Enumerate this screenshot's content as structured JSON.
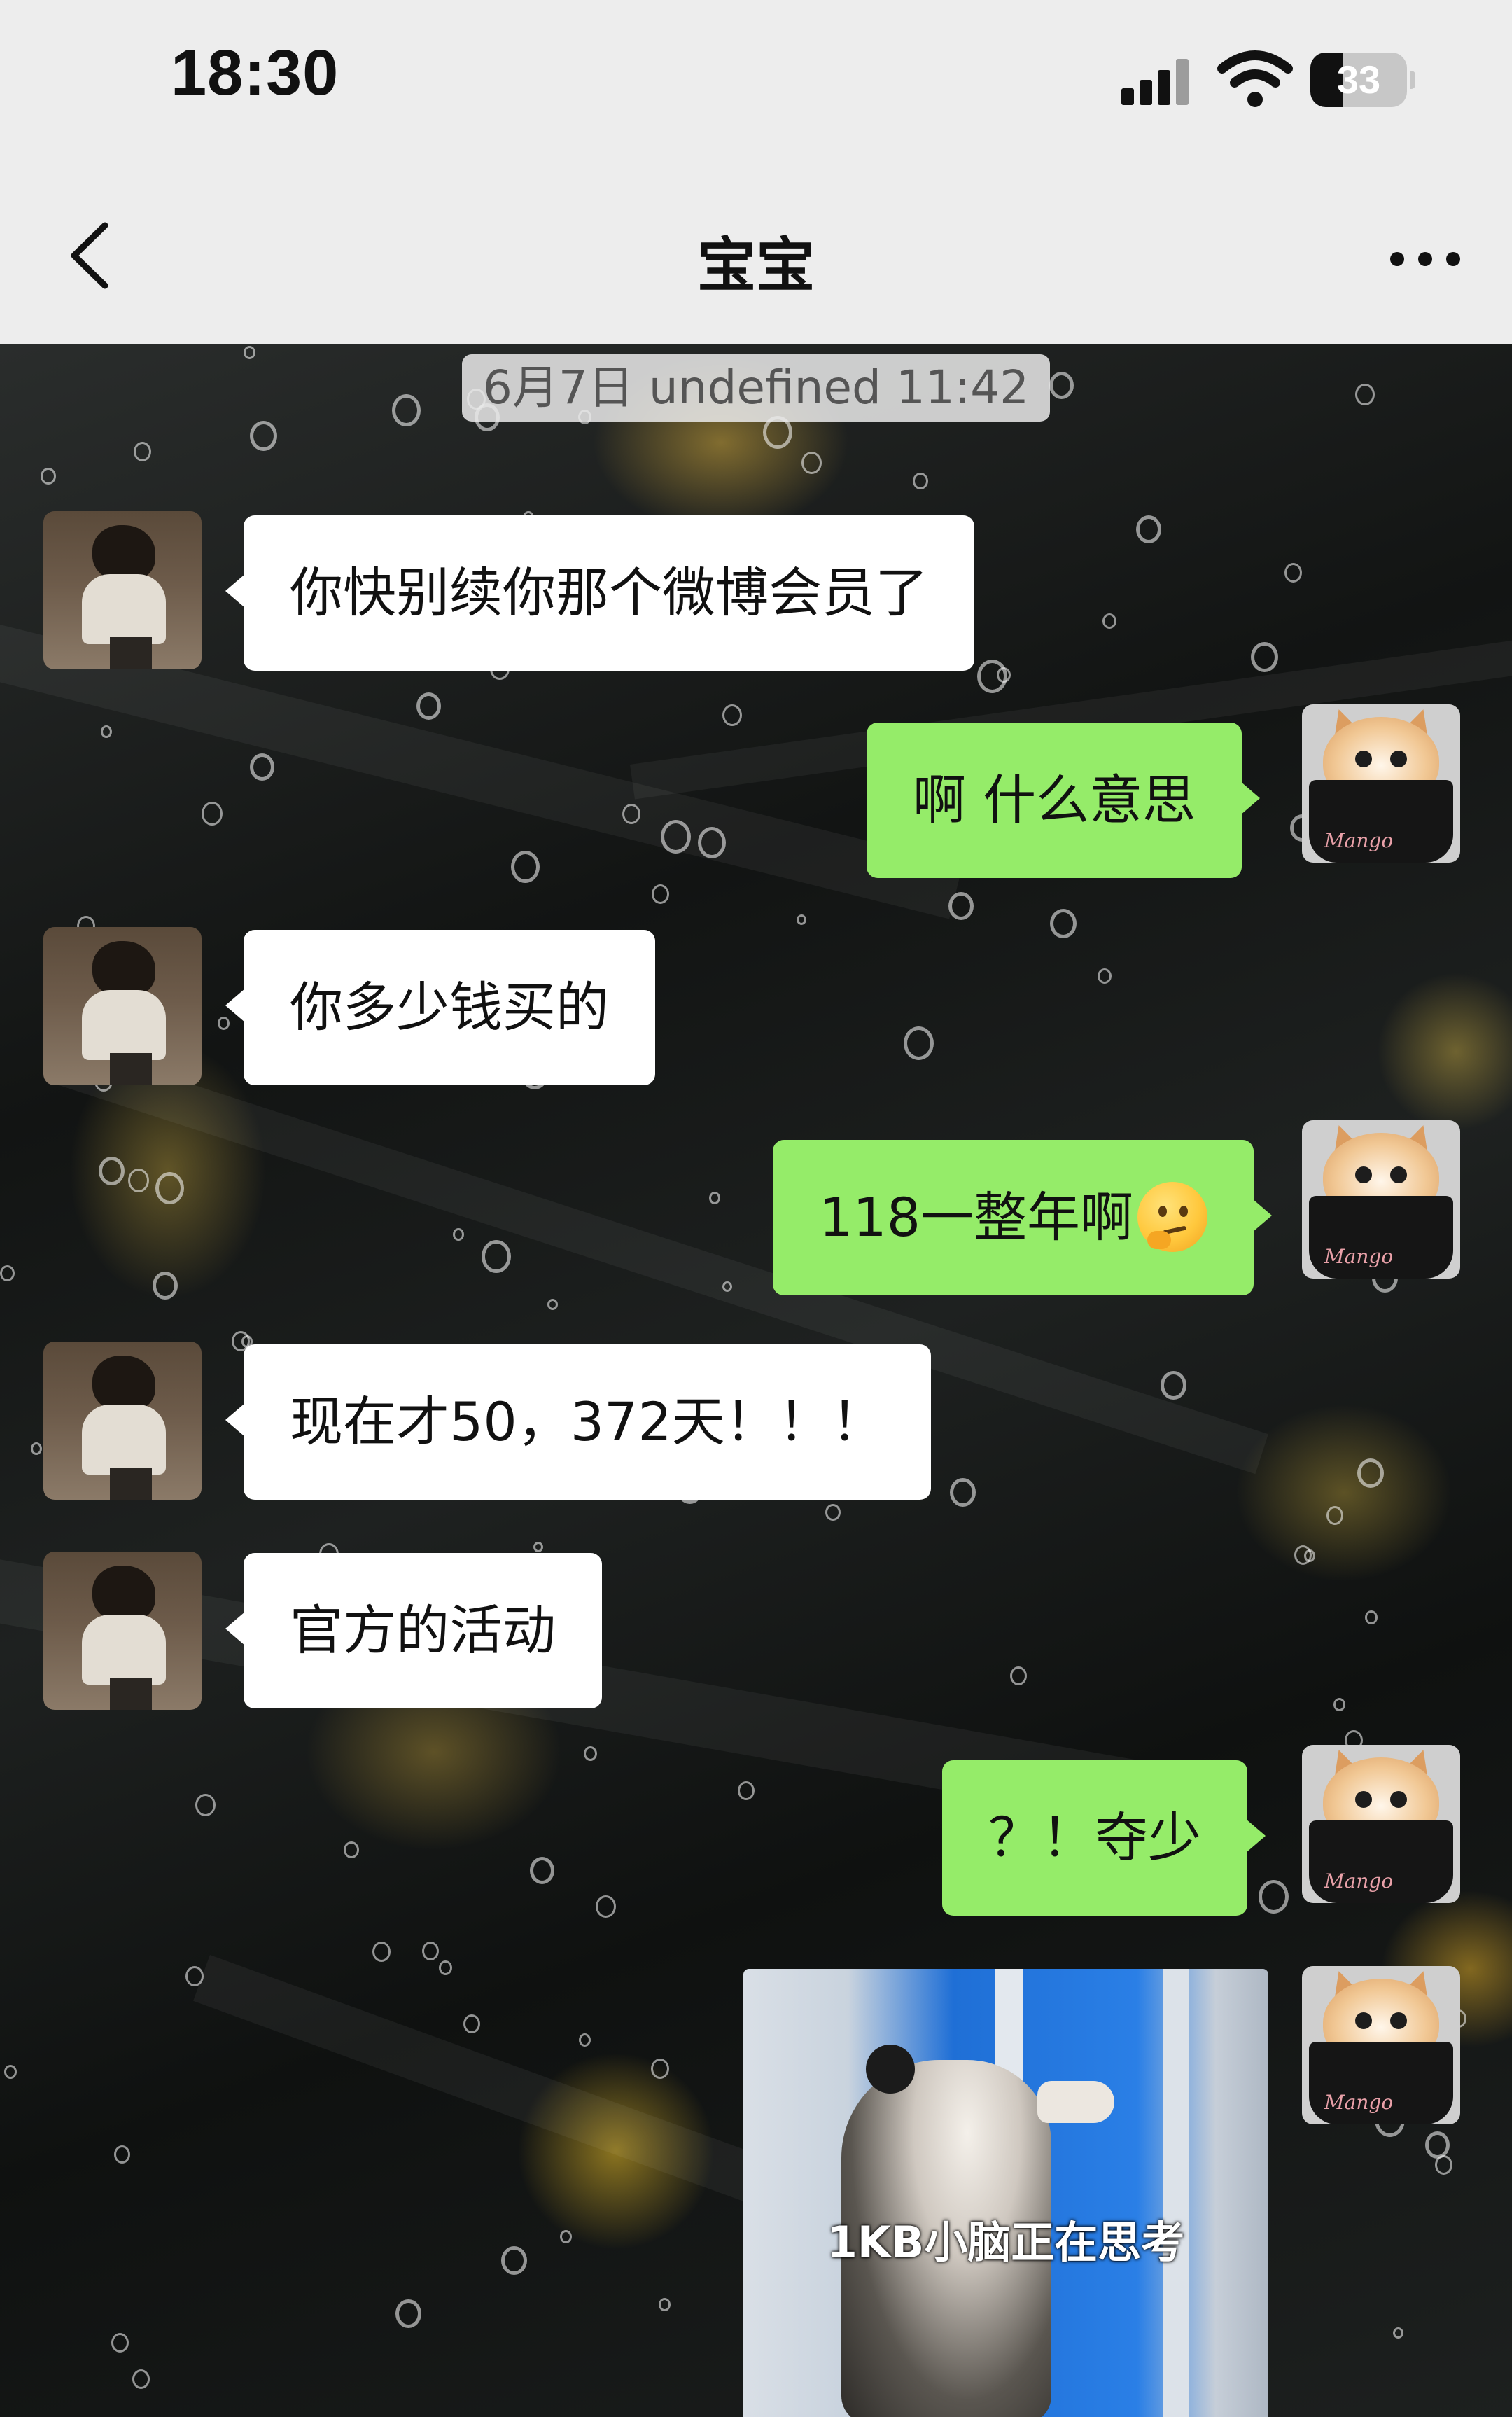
{
  "status_bar": {
    "time": "18:30",
    "battery": "33",
    "battery_level": 0.33
  },
  "nav": {
    "title": "宝宝",
    "back_icon": "chevron-left-icon",
    "more_icon": "more-dots-icon"
  },
  "chat": {
    "timestamp": "6月7日 undefined 11:42",
    "messages": [
      {
        "side": "in",
        "text": "你快别续你那个微博会员了"
      },
      {
        "side": "out",
        "text": "啊 什么意思"
      },
      {
        "side": "in",
        "text": "你多少钱买的"
      },
      {
        "side": "out",
        "text": "118一整年啊",
        "emoji": "thinking-face-icon"
      },
      {
        "side": "in",
        "text": "现在才50，372天！！！"
      },
      {
        "side": "in",
        "text": "官方的活动"
      },
      {
        "side": "out",
        "text": "？！夺少"
      },
      {
        "side": "out",
        "type": "image",
        "caption": "1KB小脑正在思考"
      }
    ],
    "avatar_brand": "Mango"
  },
  "colors": {
    "bubble_out": "#95ec69",
    "bubble_in": "#ffffff",
    "nav_bg": "#ededed"
  }
}
